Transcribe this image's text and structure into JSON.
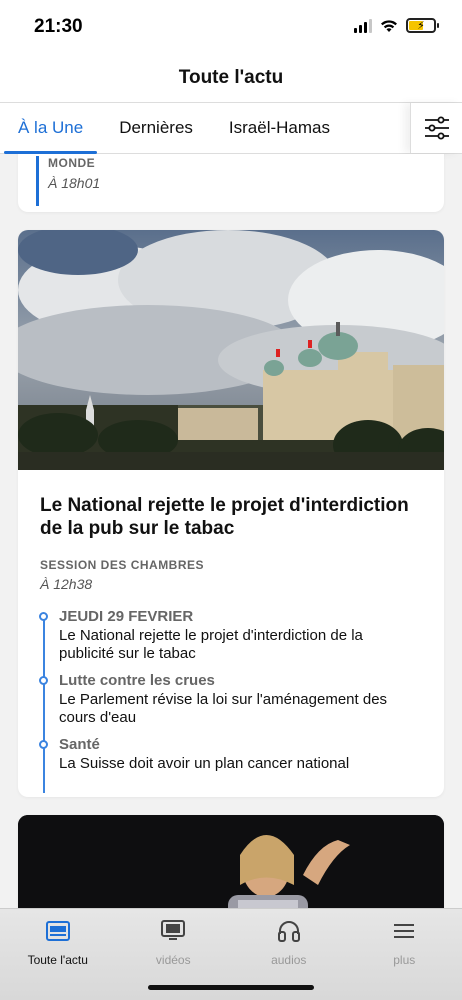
{
  "status_bar": {
    "time": "21:30"
  },
  "header": {
    "title": "Toute l'actu"
  },
  "tabs": [
    {
      "label": "À la Une",
      "active": true
    },
    {
      "label": "Dernières",
      "active": false
    },
    {
      "label": "Israël-Hamas",
      "active": false
    }
  ],
  "feed": {
    "partial_card": {
      "category": "MONDE",
      "time": "À 18h01"
    },
    "main_card": {
      "title": "Le National rejette le projet d'interdiction de la pub sur le tabac",
      "category": "SESSION DES CHAMBRES",
      "time": "À 12h38",
      "timeline": [
        {
          "label": "JEUDI 29 FEVRIER",
          "text": "Le National rejette le projet d'interdiction de la publicité sur le tabac"
        },
        {
          "label": "Lutte contre les crues",
          "text": "Le Parlement révise la loi sur l'aménagement des cours d'eau"
        },
        {
          "label": "Santé",
          "text": "La Suisse doit avoir un plan cancer national"
        }
      ]
    }
  },
  "bottom_nav": [
    {
      "label": "Toute l'actu",
      "icon": "news-icon",
      "active": true
    },
    {
      "label": "vidéos",
      "icon": "tv-icon",
      "active": false
    },
    {
      "label": "audios",
      "icon": "headphones-icon",
      "active": false
    },
    {
      "label": "plus",
      "icon": "menu-icon",
      "active": false
    }
  ],
  "colors": {
    "accent": "#1d6fd6",
    "timeline": "#3b84e0"
  }
}
